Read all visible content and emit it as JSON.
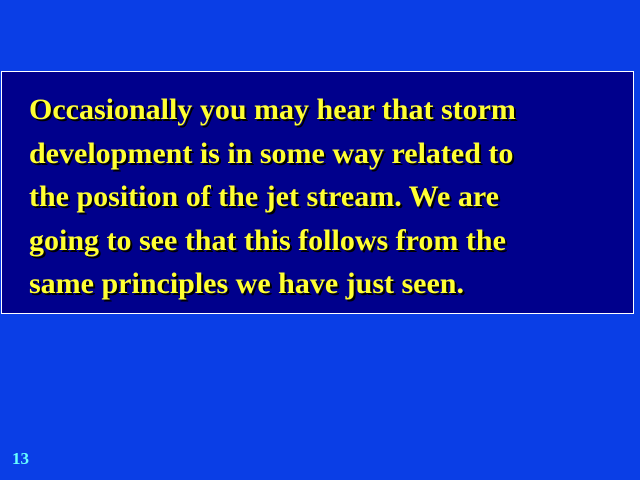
{
  "slide": {
    "body_text": "Occasionally you may hear that storm\ndevelopment is in some way related to\nthe position of the jet stream. We are\ngoing to see that this follows from the\nsame principles we have just seen.",
    "page_number": "13"
  },
  "colors": {
    "background": "#0a3ee6",
    "text_box_fill": "#00008c",
    "text_box_border": "#ffffff",
    "body_text": "#ffff33",
    "page_number": "#66ffff"
  }
}
